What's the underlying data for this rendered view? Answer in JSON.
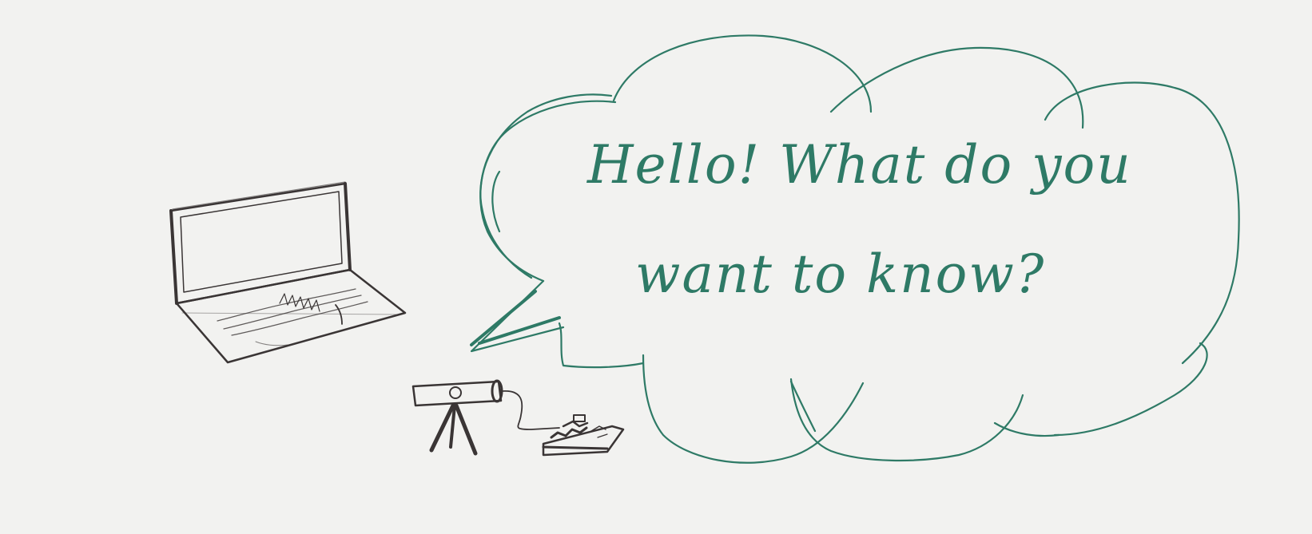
{
  "speech_bubble": {
    "line1": "Hello! What do you",
    "line2": "want  to  know?"
  },
  "colors": {
    "background": "#f2f2f0",
    "ink_green": "#2e7a66",
    "ink_dark": "#3a3535"
  },
  "icons": [
    "laptop-icon",
    "telescope-icon",
    "circuit-board-icon",
    "speech-bubble-icon"
  ]
}
